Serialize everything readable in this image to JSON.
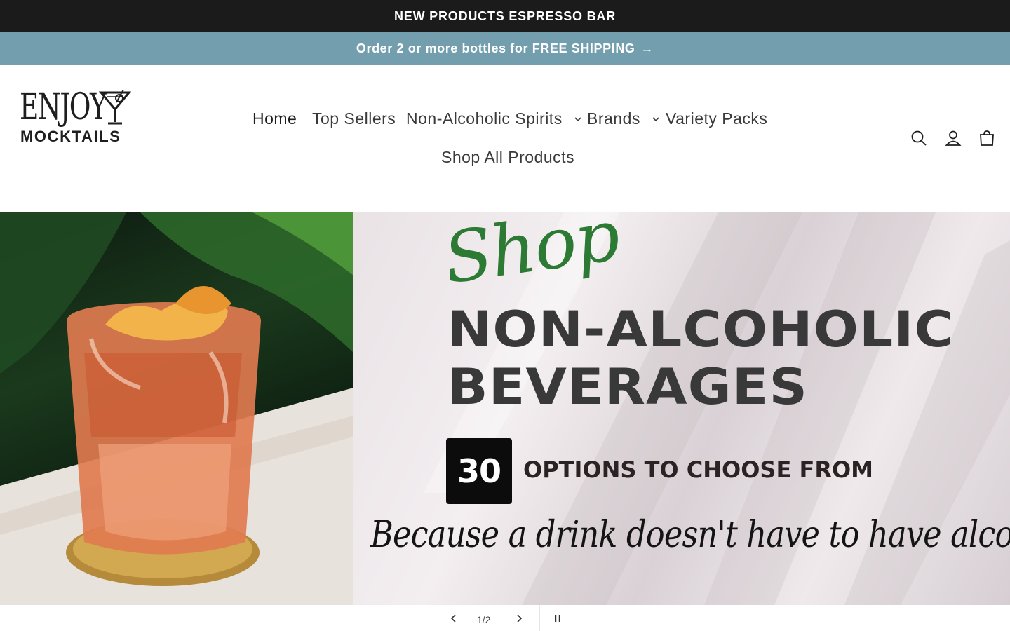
{
  "announcement": {
    "text": "NEW PRODUCTS ESPRESSO BAR"
  },
  "shipping_bar": {
    "text": "Order 2 or more bottles for FREE SHIPPING",
    "arrow": "→"
  },
  "logo": {
    "line1": "ENJOY",
    "line2": "MOCKTAILS",
    "icon": "martini-glass-icon"
  },
  "nav": {
    "items": [
      {
        "label": "Home",
        "active": true
      },
      {
        "label": "Top Sellers"
      },
      {
        "label": "Non-Alcoholic Spirits",
        "dropdown": true
      },
      {
        "label": "Brands",
        "dropdown": true
      },
      {
        "label": "Variety Packs"
      },
      {
        "label": "Shop All Products"
      }
    ]
  },
  "header_icons": [
    "search-icon",
    "account-icon",
    "cart-icon"
  ],
  "hero": {
    "script_word": "Shop",
    "headline_line1": "NON-ALCOHOLIC",
    "headline_line2": "BEVERAGES",
    "options_count": "30",
    "options_text": "OPTIONS TO CHOOSE FROM",
    "tagline": "Because a drink doesn't have to have alcohol"
  },
  "slideshow": {
    "counter": "1/2",
    "icons": [
      "chevron-left-icon",
      "chevron-right-icon",
      "pause-icon"
    ]
  },
  "colors": {
    "announcement_bg": "#1c1b1b",
    "shipping_bg": "#729ead",
    "script_green": "#2d7a34"
  }
}
